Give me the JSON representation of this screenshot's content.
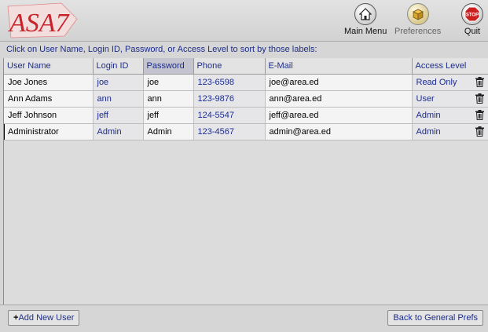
{
  "app": {
    "logo_text": "ASA7"
  },
  "toolbar": {
    "main_menu": "Main Menu",
    "preferences": "Preferences",
    "quit": "Quit",
    "stop_text": "STOP"
  },
  "instruction": "Click on User Name, Login ID, Password, or Access Level to sort by those labels:",
  "columns": {
    "user_name": "User Name",
    "login_id": "Login ID",
    "password": "Password",
    "phone": "Phone",
    "email": "E-Mail",
    "access_level": "Access Level"
  },
  "users": [
    {
      "name": "Joe Jones",
      "login": "joe",
      "password": "joe",
      "phone": "123-6598",
      "email": "joe@area.ed",
      "access": "Read Only"
    },
    {
      "name": "Ann Adams",
      "login": "ann",
      "password": "ann",
      "phone": "123-9876",
      "email": "ann@area.ed",
      "access": "User"
    },
    {
      "name": "Jeff Johnson",
      "login": "jeff",
      "password": "jeff",
      "phone": "124-5547",
      "email": "jeff@area.ed",
      "access": "Admin"
    },
    {
      "name": "Administrator",
      "login": "Admin",
      "password": "Admin",
      "phone": "123-4567",
      "email": "admin@area.ed",
      "access": "Admin"
    }
  ],
  "footer": {
    "add_user": "Add New User",
    "add_prefix": "+",
    "back": "Back to General Prefs"
  },
  "icons": {
    "main_menu": "house-icon",
    "preferences": "box-icon",
    "quit": "stop-sign-icon",
    "delete": "trash-icon"
  },
  "colors": {
    "link_blue": "#1c2c8c",
    "logo_red": "#c8242c",
    "stop_red": "#cc1f1f"
  }
}
